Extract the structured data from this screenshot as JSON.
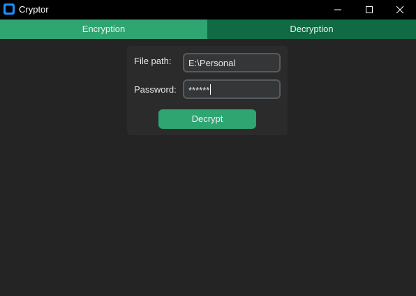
{
  "window": {
    "title": "Cryptor",
    "controls": [
      "minimize-icon",
      "maximize-icon",
      "close-icon"
    ]
  },
  "tabs": [
    {
      "label": "Encryption",
      "selected": false
    },
    {
      "label": "Decryption",
      "selected": true
    }
  ],
  "form": {
    "file_path_label": "File path:",
    "file_path_value": "E:\\Personal",
    "password_label": "Password:",
    "password_value": "******",
    "decrypt_button_label": "Decrypt"
  },
  "colors": {
    "accent": "#2fa572",
    "tab_selected": "#106a43",
    "background": "#242424",
    "panel": "#2b2b2b",
    "field_bg": "#343638",
    "field_border": "#565b5e"
  }
}
